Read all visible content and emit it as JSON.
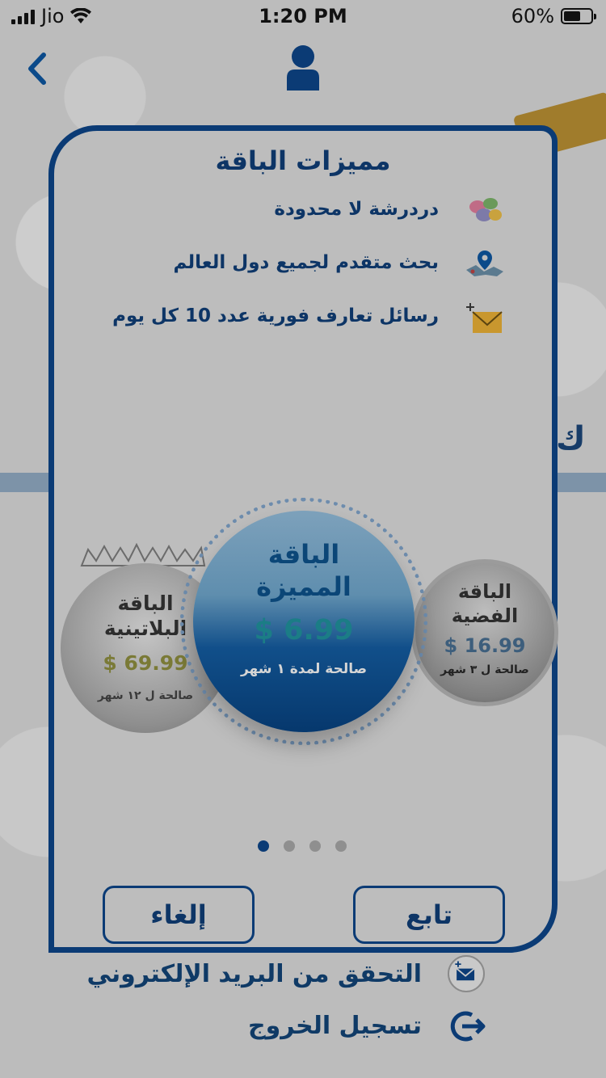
{
  "status_bar": {
    "carrier": "Jio",
    "time": "1:20 PM",
    "battery": "60%"
  },
  "background": {
    "menu": [
      {
        "label": "التحقق من البريد الإلكتروني",
        "icon": "mail-plus-icon"
      },
      {
        "label": "تسجيل الخروج",
        "icon": "logout-icon"
      }
    ],
    "partial_letter": "ك"
  },
  "modal": {
    "title": "مميزات الباقة",
    "features": [
      {
        "text": "دردرشة لا محدودة",
        "icon": "chat-bubbles-icon"
      },
      {
        "text": "بحث متقدم لجميع دول العالم",
        "icon": "world-map-pin-icon"
      },
      {
        "text": "رسائل تعارف فورية عدد 10 كل يوم",
        "icon": "envelope-plus-icon"
      }
    ],
    "packages": {
      "platinum": {
        "name_line1": "الباقة",
        "name_line2": "البلاتينية",
        "price": "$ 69.99",
        "validity": "صالحة ل ١٢ شهر"
      },
      "premium": {
        "name_line1": "الباقة",
        "name_line2": "المميزة",
        "price": "$ 6.99",
        "validity": "صالحة لمدة ١ شهر"
      },
      "silver": {
        "name_line1": "الباقة",
        "name_line2": "الفضية",
        "price": "$ 16.99",
        "validity": "صالحة ل ٣ شهر"
      }
    },
    "pager": {
      "count": 4,
      "active_index": 0
    },
    "cancel_label": "إلغاء",
    "continue_label": "تابع"
  },
  "colors": {
    "primary": "#0b3b75",
    "dim_background": "#bdbdbd"
  }
}
